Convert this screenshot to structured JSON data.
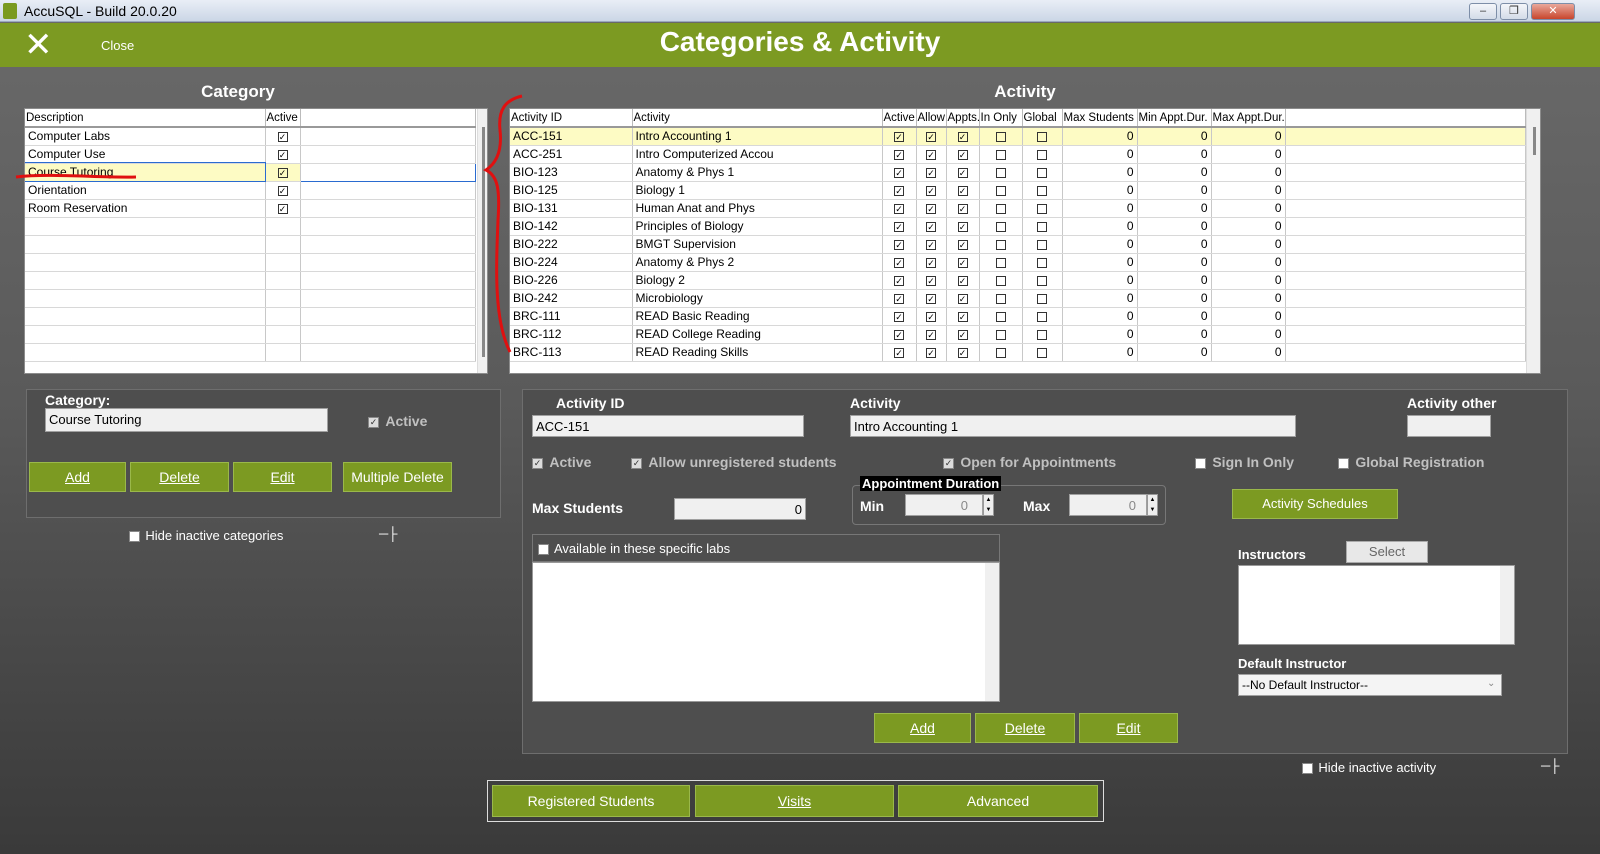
{
  "window": {
    "title": "AccuSQL - Build 20.0.20"
  },
  "header": {
    "close_label": "Close",
    "title": "Categories & Activity"
  },
  "category_section": {
    "title": "Category",
    "columns": [
      "Description",
      "Active"
    ],
    "rows": [
      {
        "description": "Computer Labs",
        "active": true
      },
      {
        "description": "Computer Use",
        "active": true
      },
      {
        "description": "Course Tutoring",
        "active": true
      },
      {
        "description": "Orientation",
        "active": true
      },
      {
        "description": "Room Reservation",
        "active": true
      }
    ],
    "selected_index": 2
  },
  "activity_section": {
    "title": "Activity",
    "columns": [
      "Activity ID",
      "Activity",
      "Active",
      "Allow",
      "Appts.",
      "In Only",
      "Global",
      "Max Students",
      "Min Appt.Dur.",
      "Max Appt.Dur."
    ],
    "rows": [
      {
        "id": "ACC-151",
        "name": "Intro Accounting 1",
        "active": true,
        "allow": true,
        "appts": true,
        "in_only": false,
        "global": false,
        "max_students": "0",
        "min_dur": "0",
        "max_dur": "0"
      },
      {
        "id": "ACC-251",
        "name": "Intro Computerized Accou",
        "active": true,
        "allow": true,
        "appts": true,
        "in_only": false,
        "global": false,
        "max_students": "0",
        "min_dur": "0",
        "max_dur": "0"
      },
      {
        "id": "BIO-123",
        "name": "Anatomy & Phys 1",
        "active": true,
        "allow": true,
        "appts": true,
        "in_only": false,
        "global": false,
        "max_students": "0",
        "min_dur": "0",
        "max_dur": "0"
      },
      {
        "id": "BIO-125",
        "name": "Biology 1",
        "active": true,
        "allow": true,
        "appts": true,
        "in_only": false,
        "global": false,
        "max_students": "0",
        "min_dur": "0",
        "max_dur": "0"
      },
      {
        "id": "BIO-131",
        "name": "Human Anat and Phys",
        "active": true,
        "allow": true,
        "appts": true,
        "in_only": false,
        "global": false,
        "max_students": "0",
        "min_dur": "0",
        "max_dur": "0"
      },
      {
        "id": "BIO-142",
        "name": "Principles of Biology",
        "active": true,
        "allow": true,
        "appts": true,
        "in_only": false,
        "global": false,
        "max_students": "0",
        "min_dur": "0",
        "max_dur": "0"
      },
      {
        "id": "BIO-222",
        "name": "BMGT Supervision",
        "active": true,
        "allow": true,
        "appts": true,
        "in_only": false,
        "global": false,
        "max_students": "0",
        "min_dur": "0",
        "max_dur": "0"
      },
      {
        "id": "BIO-224",
        "name": "Anatomy & Phys 2",
        "active": true,
        "allow": true,
        "appts": true,
        "in_only": false,
        "global": false,
        "max_students": "0",
        "min_dur": "0",
        "max_dur": "0"
      },
      {
        "id": "BIO-226",
        "name": "Biology 2",
        "active": true,
        "allow": true,
        "appts": true,
        "in_only": false,
        "global": false,
        "max_students": "0",
        "min_dur": "0",
        "max_dur": "0"
      },
      {
        "id": "BIO-242",
        "name": "Microbiology",
        "active": true,
        "allow": true,
        "appts": true,
        "in_only": false,
        "global": false,
        "max_students": "0",
        "min_dur": "0",
        "max_dur": "0"
      },
      {
        "id": "BRC-111",
        "name": "READ Basic Reading",
        "active": true,
        "allow": true,
        "appts": true,
        "in_only": false,
        "global": false,
        "max_students": "0",
        "min_dur": "0",
        "max_dur": "0"
      },
      {
        "id": "BRC-112",
        "name": "READ College Reading",
        "active": true,
        "allow": true,
        "appts": true,
        "in_only": false,
        "global": false,
        "max_students": "0",
        "min_dur": "0",
        "max_dur": "0"
      },
      {
        "id": "BRC-113",
        "name": "READ Reading Skills",
        "active": true,
        "allow": true,
        "appts": true,
        "in_only": false,
        "global": false,
        "max_students": "0",
        "min_dur": "0",
        "max_dur": "0"
      }
    ],
    "selected_index": 0
  },
  "category_form": {
    "label": "Category:",
    "value": "Course Tutoring",
    "active_label": "Active",
    "buttons": {
      "add": "Add",
      "delete": "Delete",
      "edit": "Edit",
      "multiple_delete": "Multiple Delete"
    },
    "hide_inactive_label": "Hide inactive categories"
  },
  "activity_form": {
    "activity_id_label": "Activity ID",
    "activity_id_value": "ACC-151",
    "activity_label": "Activity",
    "activity_value": "Intro Accounting 1",
    "activity_other_label": "Activity other",
    "activity_other_value": "",
    "active_label": "Active",
    "allow_unregistered_label": "Allow unregistered students",
    "open_appointments_label": "Open for Appointments",
    "sign_in_only_label": "Sign In Only",
    "global_registration_label": "Global Registration",
    "max_students_label": "Max Students",
    "max_students_value": "0",
    "appt_duration_label": "Appointment Duration",
    "min_label": "Min",
    "min_value": "0",
    "max_label": "Max",
    "max_value": "0",
    "activity_schedules_label": "Activity Schedules",
    "labs_label": "Available in these specific labs",
    "instructors_label": "Instructors",
    "select_label": "Select",
    "default_instructor_label": "Default Instructor",
    "default_instructor_value": "--No Default Instructor--",
    "buttons": {
      "add": "Add",
      "delete": "Delete",
      "edit": "Edit"
    },
    "hide_inactive_label": "Hide inactive activity"
  },
  "bottom_buttons": {
    "registered_students": "Registered Students",
    "visits": "Visits",
    "advanced": "Advanced"
  },
  "colors": {
    "accent": "#7c9a22",
    "selection": "#fdfbc4",
    "annotation": "#e01010"
  }
}
